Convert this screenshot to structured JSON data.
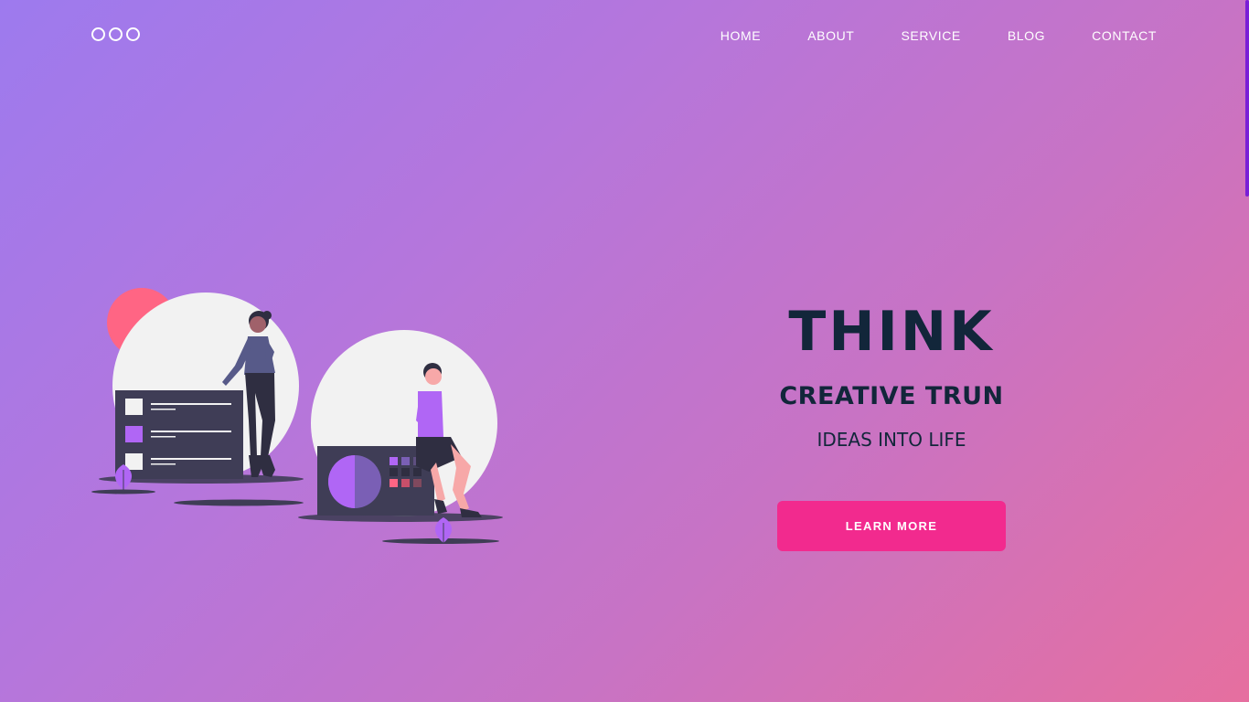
{
  "logo": {
    "icon": "three-circles-logo"
  },
  "nav": {
    "items": [
      {
        "label": "HOME"
      },
      {
        "label": "ABOUT"
      },
      {
        "label": "SERVICE"
      },
      {
        "label": "BLOG"
      },
      {
        "label": "CONTACT"
      }
    ]
  },
  "hero": {
    "title": "THINK",
    "subtitle": "CREATIVE TRUN",
    "tagline": "IDEAS INTO LIFE",
    "cta_label": "LEARN MORE"
  },
  "illustration": {
    "icon": "people-with-dashboards-illustration"
  },
  "colors": {
    "gradient_start": "#9d7aee",
    "gradient_end": "#e66f9f",
    "heading": "#12263a",
    "cta": "#f22a8e",
    "nav_text": "#ffffff",
    "accent_purple": "#b066f5",
    "accent_red": "#ff6584",
    "panel_dark": "#3f3d56",
    "scrollbar": "#7a1fd6"
  }
}
